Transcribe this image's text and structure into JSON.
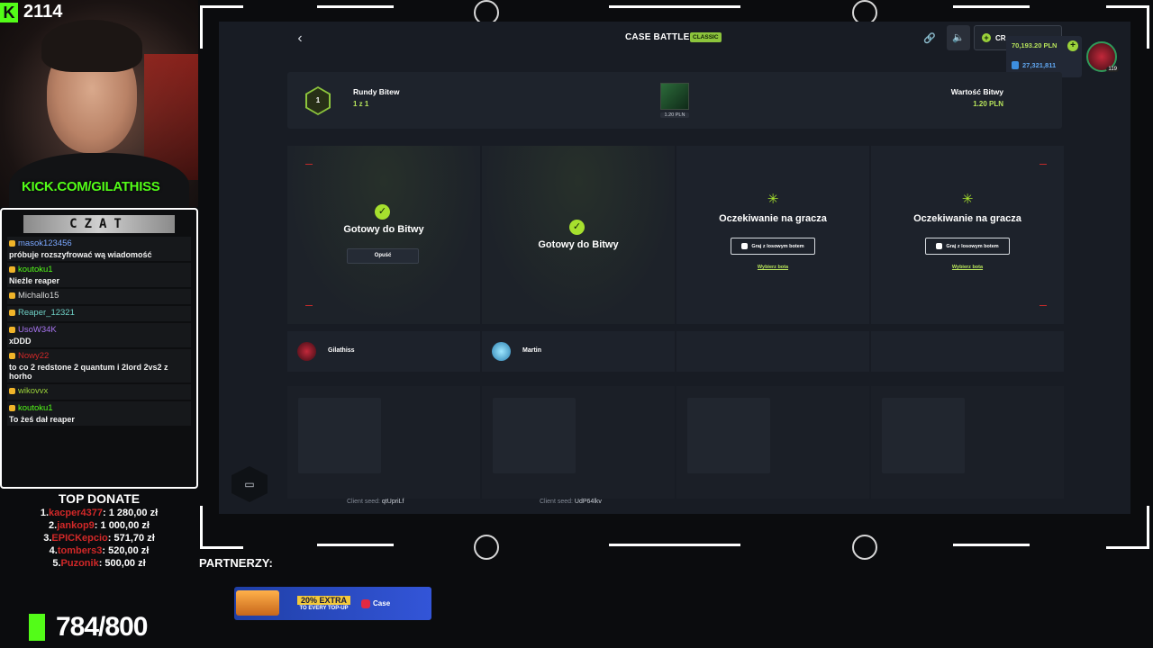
{
  "stream": {
    "kick_followers": "2114",
    "kick_url_prefix": "KICK.COM/",
    "kick_url_name": "GILATHISS",
    "chat_title": "CZAT",
    "chat": [
      {
        "user": "masok123456",
        "text": "próbuje rozszyfrować wą wiadomość",
        "color": "#7aa7ff"
      },
      {
        "user": "koutoku1",
        "text": "Nieźle reaper",
        "color": "#53fc18"
      },
      {
        "user": "Michallo15",
        "text": "",
        "color": "#d8d8d8"
      },
      {
        "user": "Reaper_12321",
        "text": "",
        "color": "#6fd0c6"
      },
      {
        "user": "UsoW34K",
        "text": "xDDD",
        "color": "#a774f0"
      },
      {
        "user": "Nowy22",
        "text": "to co 2 redstone 2 quantum i 2lord 2vs2 z horho",
        "color": "#d12828"
      },
      {
        "user": "wikovvx",
        "text": "",
        "color": "#9bd23a"
      },
      {
        "user": "koutoku1",
        "text": "To żeś dał reaper",
        "color": "#53fc18"
      }
    ],
    "top_donate_title": "TOP DONATE",
    "top_donate": [
      {
        "rank": "1.",
        "name": "kacper4377",
        "amount": ": 1 280,00 zł"
      },
      {
        "rank": "2.",
        "name": "jankop9",
        "amount": ": 1 000,00 zł"
      },
      {
        "rank": "3.",
        "name": "EPICKepcio",
        "amount": ": 571,70 zł"
      },
      {
        "rank": "4.",
        "name": "tombers3",
        "amount": ": 520,00 zł"
      },
      {
        "rank": "5.",
        "name": "Puzonik",
        "amount": ": 500,00 zł"
      }
    ],
    "goal": "784/800",
    "partners_label": "PARTNERZY:",
    "banner": {
      "offer": "20% EXTRA",
      "sub": "TO EVERY TOP-UP",
      "brand": "Case"
    }
  },
  "site": {
    "title": "CASE BATTLE",
    "mode_badge": "CLASSIC",
    "create_label": "CR",
    "balance_pln": "70,193.20 PLN",
    "balance_coins": "27,321,811",
    "avatar_level": "119",
    "rounds_number": "1",
    "rounds_label": "Rundy Bitew",
    "rounds_value": "1 z 1",
    "case_price": "1.20 PLN",
    "value_label": "Wartość Bitwy",
    "value_amount": "1.20 PLN",
    "ready_text": "Gotowy do Bitwy",
    "leave_label": "Opuść",
    "waiting_text": "Oczekiwanie na gracza",
    "bot_button": "Graj z losowym botem",
    "choose_bot": "Wybierz bota",
    "players": [
      "Gilathiss",
      "Martin"
    ],
    "seed_label": "Client seed:",
    "seeds": [
      "qtUpriLf",
      "UdP64lkv"
    ]
  }
}
